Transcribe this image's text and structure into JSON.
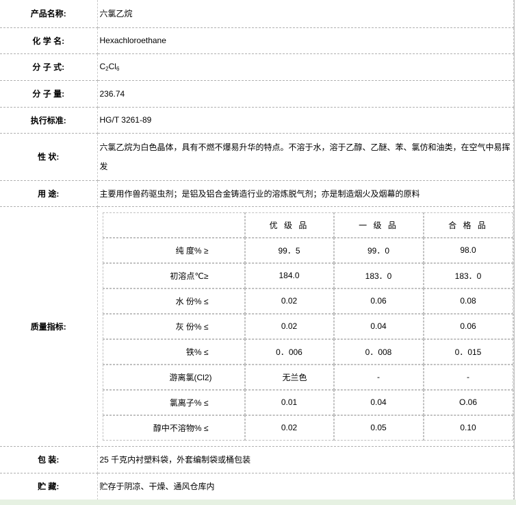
{
  "rows": {
    "name": {
      "label": "产品名称:",
      "value": "六氯乙烷"
    },
    "chem": {
      "label": "化 学 名:",
      "value": "Hexachloroethane"
    },
    "formula": {
      "label": "分 子 式:",
      "value_prefix": "C",
      "sub1": "2",
      "value_mid": "Cl",
      "sub2": "6"
    },
    "weight": {
      "label": "分 子 量:",
      "value": "236.74"
    },
    "standard": {
      "label": "执行标准:",
      "value": "HG/T 3261-89"
    },
    "property": {
      "label": "性 状:",
      "value": "六氯乙烷为白色晶体，具有不燃不爆易升华的特点。不溶于水，溶于乙醇、乙醚、苯、氯仿和油类，在空气中易挥发"
    },
    "usage": {
      "label": "用 途:",
      "value": "主要用作兽药驱虫剂；是铝及铝合金铸造行业的溶炼脱气剂；亦是制造烟火及烟幕的原料"
    },
    "quality": {
      "label": "质量指标:"
    },
    "packing": {
      "label": "包 装:",
      "value": "25 千克内衬塑料袋，外套编制袋或桶包装"
    },
    "storage": {
      "label": "贮 藏:",
      "value": "贮存于阴凉、干燥、通风仓库内"
    }
  },
  "quality_table": {
    "headers": [
      "",
      "优 级 品",
      "一 级 品",
      "合 格 品"
    ],
    "rows": [
      [
        "纯  度% ≥",
        "99．5",
        "99．0",
        "98.0"
      ],
      [
        "初溶点℃≥",
        "184.0",
        "183．0",
        "183．0"
      ],
      [
        "水  份% ≤",
        "0.02",
        "0.06",
        "0.08"
      ],
      [
        "灰  份% ≤",
        "0.02",
        "0.04",
        "0.06"
      ],
      [
        "铁% ≤",
        "0．006",
        "0．008",
        "0．015"
      ],
      [
        "游离氯(Cl2)",
        "无兰色",
        "-",
        "-"
      ],
      [
        "氯离子% ≤",
        "0.01",
        "0.04",
        "O.06"
      ],
      [
        "醇中不溶物% ≤",
        "0.02",
        "0.05",
        "0.10"
      ]
    ]
  }
}
